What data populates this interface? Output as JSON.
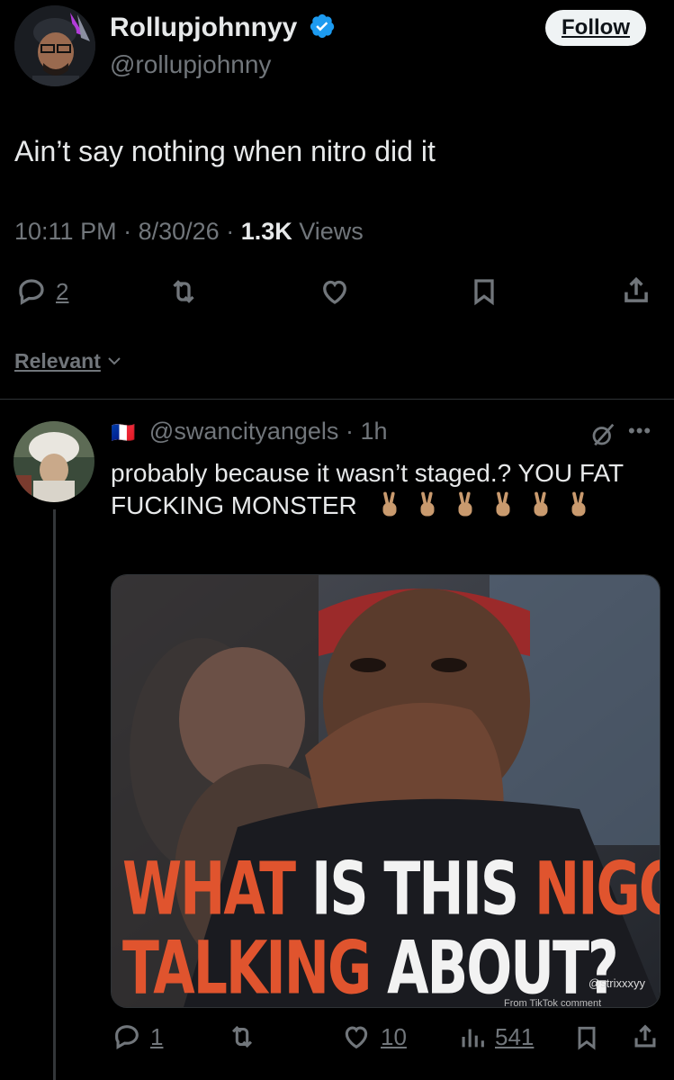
{
  "tweet": {
    "author_name": "Rollupjohnnyy",
    "author_handle": "@rollupjohnny",
    "follow_label": "Follow",
    "text": "Ain’t say nothing when nitro did it",
    "time": "10:11 PM",
    "date": "8/30/26",
    "views_count": "1.3K",
    "views_label": "Views",
    "actions": {
      "replies": "2"
    }
  },
  "sort": {
    "label": "Relevant"
  },
  "reply": {
    "flag": "🇫🇷",
    "handle": "@swancityangels",
    "time_ago": "1h",
    "text": "probably because it wasn’t staged.? YOU FAT FUCKING MONSTER",
    "media": {
      "caption_line1_a": "WHAT",
      "caption_line1_b": "IS THIS",
      "caption_line1_c": "NIGGA",
      "caption_line2_a": "TALKING",
      "caption_line2_b": "ABOUT?",
      "watermark": "@strixxxyy",
      "source": "From TikTok comment"
    },
    "actions": {
      "replies": "1",
      "likes": "10",
      "views": "541"
    }
  },
  "colors": {
    "background": "#000000",
    "text": "#e7e9ea",
    "muted": "#71767b",
    "verified": "#1d9bf0",
    "caption_red": "#e0542e"
  }
}
